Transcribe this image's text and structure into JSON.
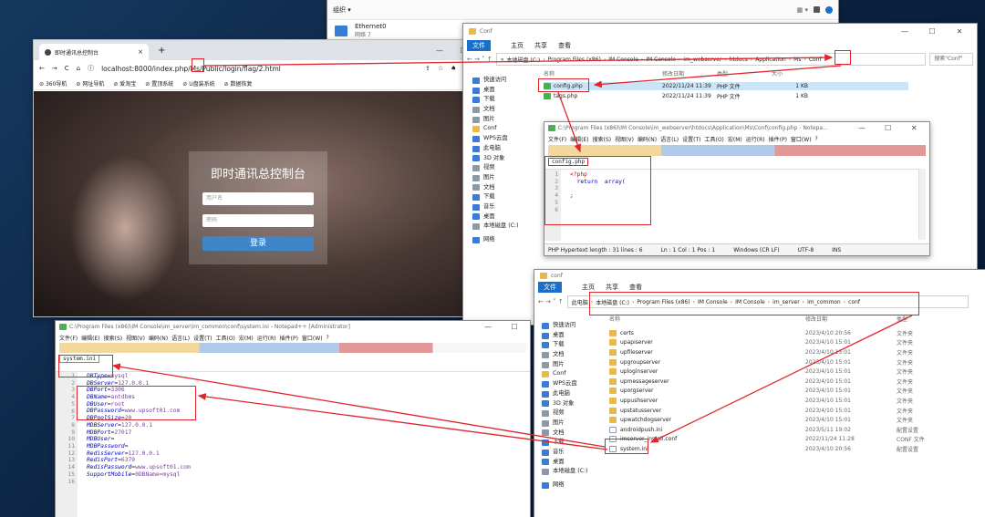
{
  "colors": {
    "accent": "#1a6fc9",
    "annotation": "#e0242c",
    "login_button": "#3f86c9"
  },
  "net_window": {
    "menu": "组织 ▾",
    "adapter_name": "Ethernet0",
    "adapter_status": "网络 7"
  },
  "browser": {
    "tab_title": "即时通讯总控制台",
    "tab_close": "×",
    "new_tab": "+",
    "url": "localhost:8000/index.php/Ms/Public/login/flag/2.html",
    "bookmarks": [
      "360导航",
      "网址导航",
      "爱淘宝",
      "置顶系统",
      "U盘装系统",
      "数据恢复"
    ],
    "login": {
      "title": "即时通讯总控制台",
      "username_placeholder": "用户名",
      "password_placeholder": "密码",
      "submit": "登录"
    }
  },
  "explorer_conf": {
    "title": "Conf",
    "ribbon": [
      "文件",
      "主页",
      "共享",
      "查看"
    ],
    "breadcrumb": [
      "«",
      "本地磁盘 (C:)",
      "Program Files (x86)",
      "IM Console",
      "IM Console",
      "im_webserver",
      "htdocs",
      "Application",
      "Ms",
      "Conf"
    ],
    "search_placeholder": "搜索\"Conf\"",
    "columns": [
      "名称",
      "修改日期",
      "类型",
      "大小"
    ],
    "files": [
      {
        "name": "config.php",
        "date": "2022/11/24 11:39",
        "type": "PHP 文件",
        "size": "1 KB"
      },
      {
        "name": "tags.php",
        "date": "2022/11/24 11:39",
        "type": "PHP 文件",
        "size": "1 KB"
      }
    ],
    "nav": [
      "快速访问",
      "桌面",
      "下载",
      "文档",
      "图片",
      "Conf",
      "WPS云盘",
      "此电脑",
      "3D 对象",
      "视频",
      "图片",
      "文档",
      "下载",
      "音乐",
      "桌面",
      "本地磁盘 (C:)",
      "网络"
    ]
  },
  "npp_config": {
    "title": "C:\\Program Files (x86)\\IM Console\\im_webserver\\htdocs\\Application\\Ms\\Conf\\config.php - Notepa...",
    "menu": [
      "文件(F)",
      "编辑(E)",
      "搜索(S)",
      "视图(V)",
      "编码(N)",
      "语言(L)",
      "设置(T)",
      "工具(O)",
      "宏(M)",
      "运行(R)",
      "插件(P)",
      "窗口(W)",
      "?"
    ],
    "tab": "config.php",
    "lines": [
      "<?php",
      "  return  array(",
      "",
      ";",
      "",
      " "
    ],
    "line_numbers": [
      "1",
      "2",
      "3",
      "4",
      "5",
      "6"
    ],
    "status": {
      "info": "PHP Hypertext length : 31    lines : 6",
      "pos": "Ln : 1    Col : 1    Pos : 1",
      "eol": "Windows (CR LF)",
      "enc": "UTF-8",
      "mode": "INS"
    }
  },
  "explorer_common": {
    "title": "conf",
    "ribbon": [
      "文件",
      "主页",
      "共享",
      "查看"
    ],
    "breadcrumb": [
      "此电脑",
      "本地磁盘 (C:)",
      "Program Files (x86)",
      "IM Console",
      "IM Console",
      "im_server",
      "im_common",
      "conf"
    ],
    "columns": [
      "名称",
      "修改日期",
      "类型"
    ],
    "files": [
      {
        "name": "certs",
        "date": "2023/4/10 20:56",
        "type": "文件夹",
        "kind": "folder"
      },
      {
        "name": "upapiserver",
        "date": "2023/4/10 15:01",
        "type": "文件夹",
        "kind": "folder"
      },
      {
        "name": "upfileserver",
        "date": "2023/4/10 15:01",
        "type": "文件夹",
        "kind": "folder"
      },
      {
        "name": "upgroupserver",
        "date": "2023/4/10 15:01",
        "type": "文件夹",
        "kind": "folder"
      },
      {
        "name": "uploginserver",
        "date": "2023/4/10 15:01",
        "type": "文件夹",
        "kind": "folder"
      },
      {
        "name": "upmessageserver",
        "date": "2023/4/10 15:01",
        "type": "文件夹",
        "kind": "folder"
      },
      {
        "name": "uporgserver",
        "date": "2023/4/10 15:01",
        "type": "文件夹",
        "kind": "folder"
      },
      {
        "name": "uppushserver",
        "date": "2023/4/10 15:01",
        "type": "文件夹",
        "kind": "folder"
      },
      {
        "name": "upstatusserver",
        "date": "2023/4/10 15:01",
        "type": "文件夹",
        "kind": "folder"
      },
      {
        "name": "upwatchdogserver",
        "date": "2023/4/10 15:01",
        "type": "文件夹",
        "kind": "folder"
      },
      {
        "name": "androidpush.ini",
        "date": "2023/5/11 19:02",
        "type": "配置设置",
        "kind": "file"
      },
      {
        "name": "imserver_install.conf",
        "date": "2022/11/24 11:28",
        "type": "CONF 文件",
        "kind": "file"
      },
      {
        "name": "system.ini",
        "date": "2023/4/10 20:56",
        "type": "配置设置",
        "kind": "file"
      }
    ],
    "nav": [
      "快速访问",
      "桌面",
      "下载",
      "文档",
      "图片",
      "Conf",
      "WPS云盘",
      "此电脑",
      "3D 对象",
      "视频",
      "图片",
      "文档",
      "下载",
      "音乐",
      "桌面",
      "本地磁盘 (C:)",
      "网络"
    ]
  },
  "npp_system": {
    "title": "C:\\Program Files (x86)\\IM Console\\im_server\\im_common\\conf\\system.ini - Notepad++ [Administrator]",
    "menu": [
      "文件(F)",
      "编辑(E)",
      "搜索(S)",
      "视图(V)",
      "编码(N)",
      "语言(L)",
      "设置(T)",
      "工具(O)",
      "宏(M)",
      "运行(R)",
      "插件(P)",
      "窗口(W)",
      "?"
    ],
    "tab": "system.ini",
    "line_numbers": [
      "1",
      "2",
      "3",
      "4",
      "5",
      "6",
      "7",
      "8",
      "9",
      "10",
      "11",
      "12",
      "13",
      "14",
      "15",
      "16"
    ],
    "lines": [
      {
        "k": "DBType",
        "v": "mysql"
      },
      {
        "k": "DBServer",
        "v": "127.0.0.1"
      },
      {
        "k": "DBPort",
        "v": "3306"
      },
      {
        "k": "DBName",
        "v": "antdbms"
      },
      {
        "k": "DBUser",
        "v": "root"
      },
      {
        "k": "DBPassword",
        "v": "www.upsoft01.com"
      },
      {
        "k": "DBPoolSize",
        "v": "20"
      },
      {
        "k": "MDBServer",
        "v": "127.0.0.1"
      },
      {
        "k": "MDBPort",
        "v": "27017"
      },
      {
        "k": "MDBUser",
        "v": ""
      },
      {
        "k": "MDBPassword",
        "v": ""
      },
      {
        "k": "RedisServer",
        "v": "127.0.0.1"
      },
      {
        "k": "RedisPort",
        "v": "6379"
      },
      {
        "k": "RedisPassword",
        "v": "www.upsoft01.com"
      },
      {
        "k": "SupportMobile",
        "v": "0DBName=mysql"
      },
      {
        "k": "",
        "v": ""
      }
    ]
  }
}
